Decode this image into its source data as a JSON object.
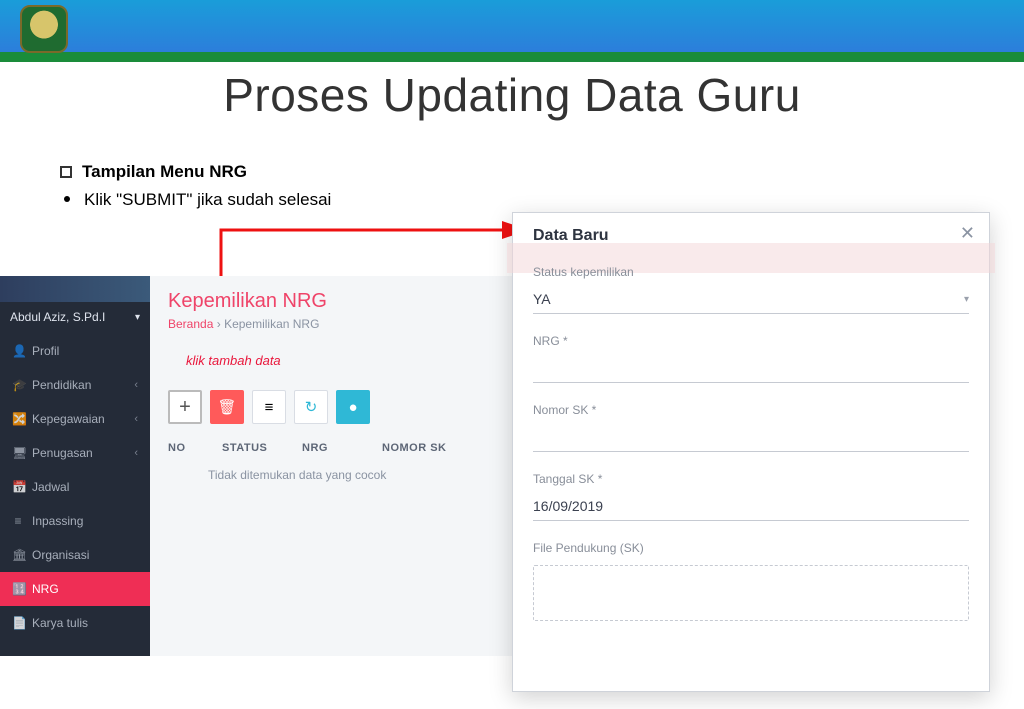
{
  "slide": {
    "title": "Proses Updating Data Guru",
    "heading": "Tampilan Menu NRG",
    "subline": "Klik \"SUBMIT\"  jika sudah selesai",
    "annotation": "klik tambah data"
  },
  "sidebar": {
    "user": "Abdul Aziz, S.Pd.I",
    "items": [
      {
        "icon": "👤",
        "label": "Profil",
        "expandable": false
      },
      {
        "icon": "🎓",
        "label": "Pendidikan",
        "expandable": true
      },
      {
        "icon": "🔀",
        "label": "Kepegawaian",
        "expandable": true
      },
      {
        "icon": "🖥",
        "label": "Penugasan",
        "expandable": true
      },
      {
        "icon": "📅",
        "label": "Jadwal",
        "expandable": false
      },
      {
        "icon": "≡",
        "label": "Inpassing",
        "expandable": false
      },
      {
        "icon": "🏛",
        "label": "Organisasi",
        "expandable": false
      },
      {
        "icon": "🔢",
        "label": "NRG",
        "expandable": false,
        "active": true
      },
      {
        "icon": "📄",
        "label": "Karya tulis",
        "expandable": false
      }
    ]
  },
  "page": {
    "title": "Kepemilikan NRG",
    "crumb_home": "Beranda",
    "crumb_sep": "›",
    "crumb_here": "Kepemilikan NRG",
    "columns": [
      "NO",
      "STATUS",
      "NRG",
      "NOMOR SK"
    ],
    "empty": "Tidak ditemukan data yang cocok",
    "toolbar": {
      "add": "+",
      "delete": "🗑",
      "list": "≡",
      "refresh": "↻",
      "clock": "●"
    }
  },
  "modal": {
    "title": "Data Baru",
    "fields": {
      "status_label": "Status kepemilikan",
      "status_value": "YA",
      "nrg_label": "NRG *",
      "nomor_label": "Nomor SK *",
      "tanggal_label": "Tanggal SK *",
      "tanggal_value": "16/09/2019",
      "file_label": "File Pendukung (SK)"
    }
  }
}
